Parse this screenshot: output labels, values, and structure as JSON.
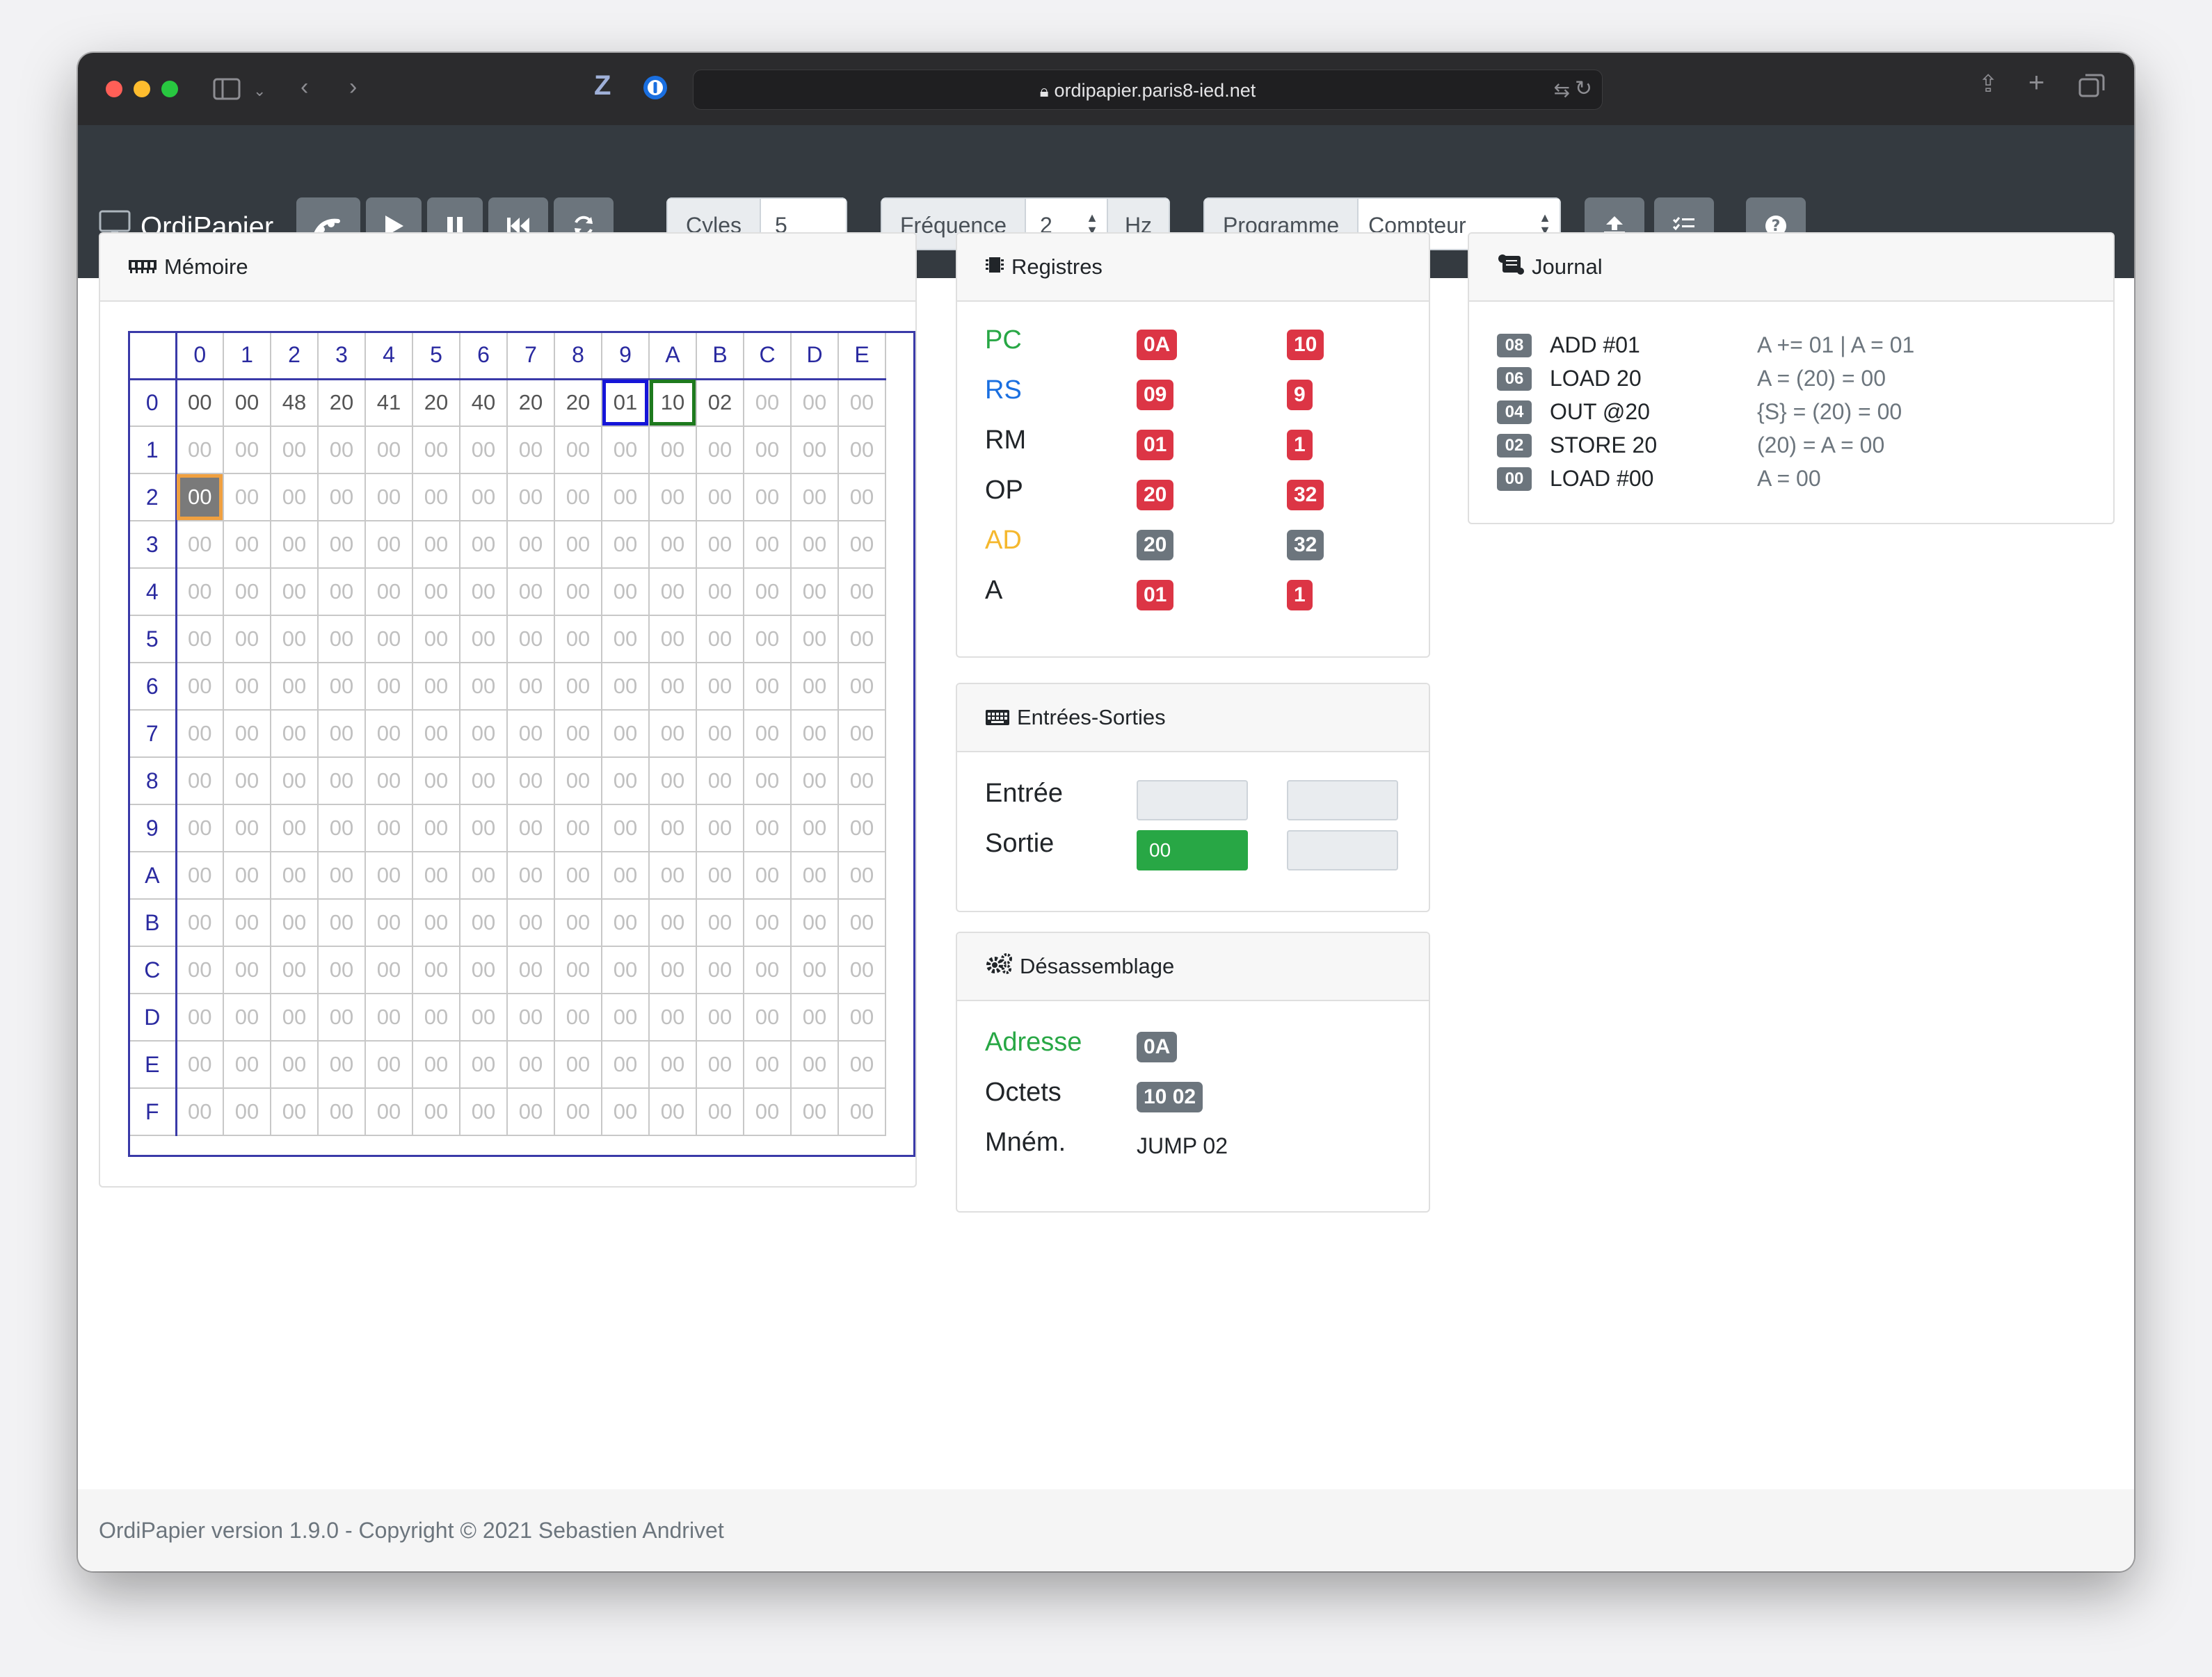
{
  "browser": {
    "url": "ordipapier.paris8-ied.net",
    "icons": [
      "sidebar-icon",
      "chevron-down-icon",
      "back-icon",
      "forward-icon",
      "z-extension-icon",
      "password-manager-icon",
      "lock-icon",
      "translate-icon",
      "reload-icon",
      "share-icon",
      "new-tab-icon",
      "tabs-overview-icon"
    ]
  },
  "navbar": {
    "brand": "OrdiPapier",
    "buttons": [
      "step-icon",
      "play-icon",
      "pause-icon",
      "rewind-icon",
      "reset-icon",
      "upload-icon",
      "list-icon",
      "help-icon"
    ],
    "cycles_label": "Cyles",
    "cycles_value": "5",
    "frequency_label": "Fréquence",
    "frequency_value": "2",
    "frequency_unit": "Hz",
    "program_label": "Programme",
    "program_value": "Compteur"
  },
  "memory": {
    "title": "Mémoire",
    "col_headers": [
      "0",
      "1",
      "2",
      "3",
      "4",
      "5",
      "6",
      "7",
      "8",
      "9",
      "A",
      "B",
      "C",
      "D",
      "E"
    ],
    "row_headers": [
      "0",
      "1",
      "2",
      "3",
      "4",
      "5",
      "6",
      "7",
      "8",
      "9",
      "A",
      "B",
      "C",
      "D",
      "E",
      "F"
    ],
    "row0": [
      "00",
      "00",
      "48",
      "20",
      "41",
      "20",
      "40",
      "20",
      "20",
      "01",
      "10",
      "02",
      "00",
      "00",
      "00"
    ],
    "fill": "00"
  },
  "registers": {
    "title": "Registres",
    "items": [
      {
        "name": "PC",
        "hex": "0A",
        "dec": "10"
      },
      {
        "name": "RS",
        "hex": "09",
        "dec": "9"
      },
      {
        "name": "RM",
        "hex": "01",
        "dec": "1"
      },
      {
        "name": "OP",
        "hex": "20",
        "dec": "32"
      },
      {
        "name": "AD",
        "hex": "20",
        "dec": "32"
      },
      {
        "name": "A",
        "hex": "01",
        "dec": "1"
      }
    ]
  },
  "io": {
    "title": "Entrées-Sorties",
    "input_label": "Entrée",
    "output_label": "Sortie",
    "output_value": "00"
  },
  "disasm": {
    "title": "Désassemblage",
    "address_label": "Adresse",
    "address_value": "0A",
    "bytes_label": "Octets",
    "bytes_value": "10 02",
    "mnem_label": "Mném.",
    "mnem_value": "JUMP 02"
  },
  "journal": {
    "title": "Journal",
    "entries": [
      {
        "addr": "08",
        "cmd": "ADD #01",
        "result": "A += 01 | A = 01"
      },
      {
        "addr": "06",
        "cmd": "LOAD 20",
        "result": "A = (20) = 00"
      },
      {
        "addr": "04",
        "cmd": "OUT @20",
        "result": "{S} = (20) = 00"
      },
      {
        "addr": "02",
        "cmd": "STORE 20",
        "result": "(20) = A = 00"
      },
      {
        "addr": "00",
        "cmd": "LOAD #00",
        "result": "A = 00"
      }
    ]
  },
  "footer": "OrdiPapier version 1.9.0 - Copyright © 2021 Sebastien Andrivet",
  "colors": {
    "navbar": "#343a40",
    "badge_red": "#dc3545",
    "badge_gray": "#6c757d",
    "pc": "#28a745",
    "rs": "#1a6fe0",
    "ad": "#f5b82e",
    "output": "#28a745",
    "memory_header": "#2a2aa0"
  }
}
